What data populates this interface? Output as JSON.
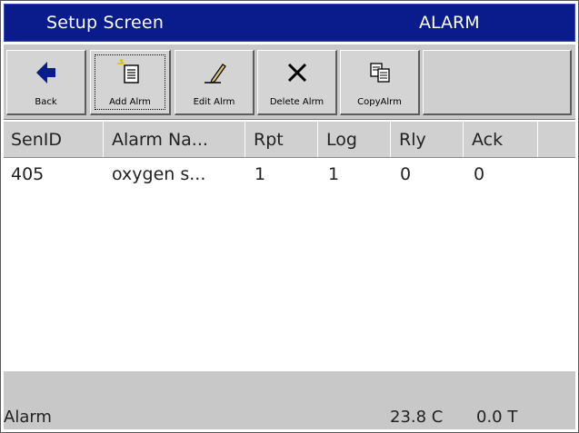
{
  "title_bar": {
    "title": "Setup Screen",
    "mode": "ALARM"
  },
  "toolbar": {
    "buttons": [
      {
        "label": "Back",
        "icon": "back-arrow-icon"
      },
      {
        "label": "Add Alrm",
        "icon": "add-document-icon"
      },
      {
        "label": "Edit Alrm",
        "icon": "pencil-icon"
      },
      {
        "label": "Delete Alrm",
        "icon": "delete-x-icon"
      },
      {
        "label": "CopyAlrm",
        "icon": "copy-icon"
      }
    ]
  },
  "table": {
    "columns": [
      "SenID",
      "Alarm Na...",
      "Rpt",
      "Log",
      "Rly",
      "Ack"
    ],
    "rows": [
      [
        "405",
        "oxygen s...",
        "1",
        "1",
        "0",
        "0"
      ]
    ]
  },
  "status_bar": {
    "label": "Alarm",
    "temperature": "23.8 C",
    "reading": "0.0 T"
  },
  "colors": {
    "title_bar_bg": "#0a1c8c",
    "toolbar_bg": "#c8c8c8",
    "accent_blue_arrow": "#0a1c8c"
  }
}
